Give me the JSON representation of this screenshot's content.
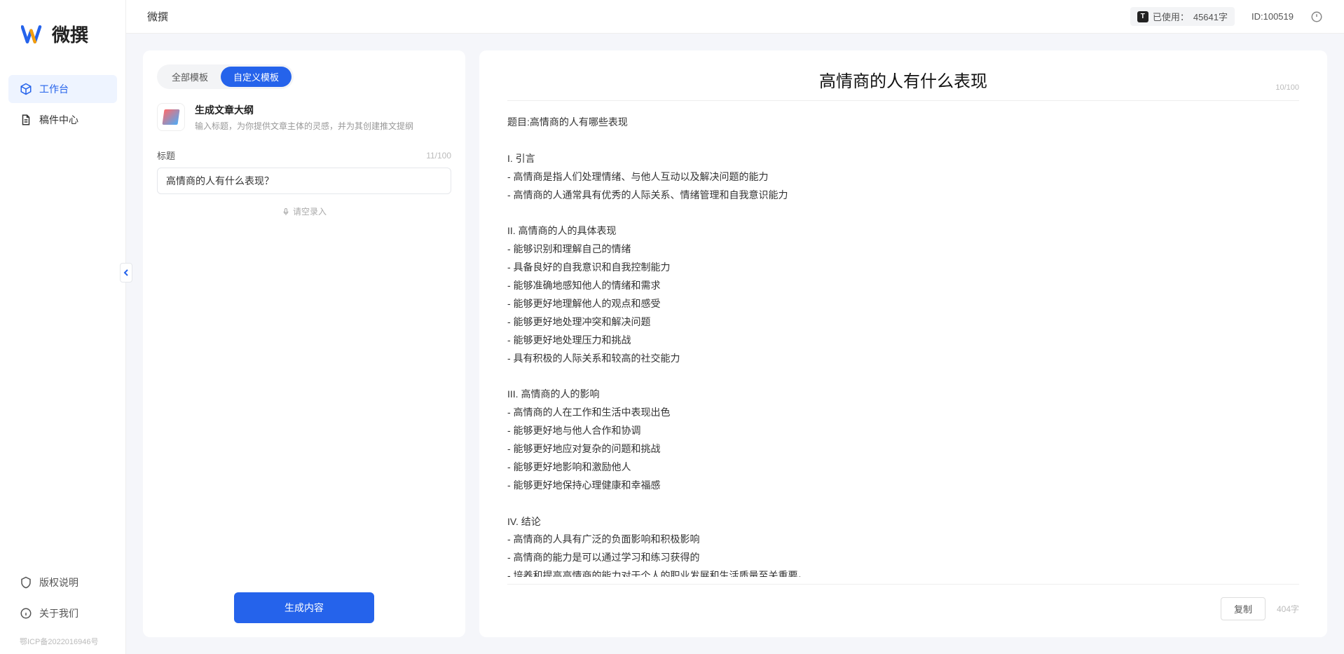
{
  "app": {
    "title": "微撰",
    "logo_text": "微撰"
  },
  "sidebar": {
    "nav": [
      {
        "label": "工作台",
        "active": true
      },
      {
        "label": "稿件中心",
        "active": false
      }
    ],
    "bottom": [
      {
        "label": "版权说明"
      },
      {
        "label": "关于我们"
      }
    ],
    "icp": "鄂ICP备2022016946号"
  },
  "topbar": {
    "usage_label": "已使用：",
    "usage_value": "45641字",
    "user_id": "ID:100519"
  },
  "left_panel": {
    "tabs": [
      {
        "label": "全部模板",
        "active": false
      },
      {
        "label": "自定义模板",
        "active": true
      }
    ],
    "template": {
      "title": "生成文章大纲",
      "desc": "输入标题，为你提供文章主体的灵感，并为其创建推文提纲"
    },
    "field": {
      "label": "标题",
      "counter": "11/100",
      "value": "高情商的人有什么表现？"
    },
    "voice_label": "请空录入",
    "generate_label": "生成内容"
  },
  "output": {
    "title": "高情商的人有什么表现",
    "title_counter": "10/100",
    "body": "题目:高情商的人有哪些表现\n\nI. 引言\n- 高情商是指人们处理情绪、与他人互动以及解决问题的能力\n- 高情商的人通常具有优秀的人际关系、情绪管理和自我意识能力\n\nII. 高情商的人的具体表现\n- 能够识别和理解自己的情绪\n- 具备良好的自我意识和自我控制能力\n- 能够准确地感知他人的情绪和需求\n- 能够更好地理解他人的观点和感受\n- 能够更好地处理冲突和解决问题\n- 能够更好地处理压力和挑战\n- 具有积极的人际关系和较高的社交能力\n\nIII. 高情商的人的影响\n- 高情商的人在工作和生活中表现出色\n- 能够更好地与他人合作和协调\n- 能够更好地应对复杂的问题和挑战\n- 能够更好地影响和激励他人\n- 能够更好地保持心理健康和幸福感\n\nIV. 结论\n- 高情商的人具有广泛的负面影响和积极影响\n- 高情商的能力是可以通过学习和练习获得的\n- 培养和提高高情商的能力对于个人的职业发展和生活质量至关重要。",
    "copy_label": "复制",
    "word_count": "404字"
  }
}
